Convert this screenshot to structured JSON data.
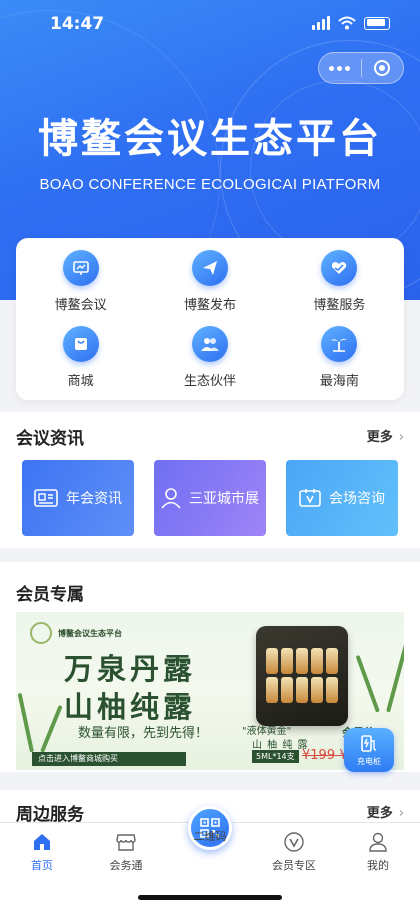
{
  "status_bar": {
    "time": "14:47"
  },
  "hero": {
    "title": "博鳌会议生态平台",
    "subtitle": "BOAO CONFERENCE ECOLOGICAI PIATFORM"
  },
  "quick_grid": [
    {
      "label": "博鳌会议",
      "icon": "chart-board-icon"
    },
    {
      "label": "博鳌发布",
      "icon": "paper-plane-icon"
    },
    {
      "label": "博鳌服务",
      "icon": "handshake-icon"
    },
    {
      "label": "商城",
      "icon": "shopping-bag-icon"
    },
    {
      "label": "生态伙伴",
      "icon": "partners-icon"
    },
    {
      "label": "最海南",
      "icon": "palm-tree-icon"
    }
  ],
  "news": {
    "title": "会议资讯",
    "more": "更多",
    "tiles": [
      {
        "label": "年会资讯",
        "icon": "id-card-icon"
      },
      {
        "label": "三亚城市展",
        "icon": "person-icon"
      },
      {
        "label": "会场咨询",
        "icon": "v-badge-icon"
      }
    ]
  },
  "member": {
    "title": "会员专属",
    "banner": {
      "logo_text": "博鳌会议生态平台",
      "line1": "万泉丹露",
      "line2": "山柚纯露",
      "slogan": "数量有限，先到先得！",
      "cta": "点击进入博鳌商城购买",
      "tag": "\"液体黄金\"",
      "tag2": "山 柚 纯 露",
      "box": "5ML*14支",
      "member_label": "会员价",
      "price": "¥199 ¥"
    }
  },
  "charge_button": {
    "label": "充电桩"
  },
  "nearby": {
    "title": "周边服务",
    "more": "更多"
  },
  "tabbar": {
    "items": [
      {
        "label": "首页",
        "icon": "home-icon"
      },
      {
        "label": "会务通",
        "icon": "store-icon"
      },
      {
        "label": "二维码",
        "icon": "qr-code-icon"
      },
      {
        "label": "会员专区",
        "icon": "vip-icon"
      },
      {
        "label": "我的",
        "icon": "user-icon"
      }
    ]
  },
  "colors": {
    "accent": "#2f6ff2",
    "banner_green": "#2b5230",
    "price_red": "#d94a3a"
  }
}
